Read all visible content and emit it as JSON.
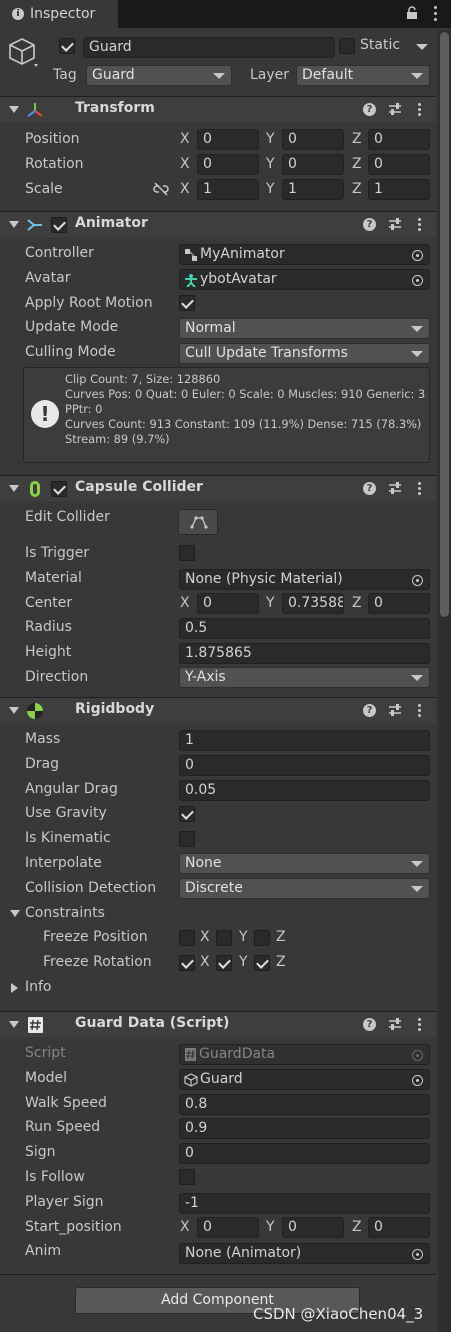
{
  "tab": {
    "title": "Inspector"
  },
  "object": {
    "name": "Guard",
    "static_label": "Static",
    "tag_label": "Tag",
    "tag_value": "Guard",
    "layer_label": "Layer",
    "layer_value": "Default"
  },
  "transform": {
    "title": "Transform",
    "position_label": "Position",
    "rotation_label": "Rotation",
    "scale_label": "Scale",
    "axes": {
      "x": "X",
      "y": "Y",
      "z": "Z"
    },
    "position": {
      "x": "0",
      "y": "0",
      "z": "0"
    },
    "rotation": {
      "x": "0",
      "y": "0",
      "z": "0"
    },
    "scale": {
      "x": "1",
      "y": "1",
      "z": "1"
    }
  },
  "animator": {
    "title": "Animator",
    "controller_label": "Controller",
    "controller_value": "MyAnimator",
    "avatar_label": "Avatar",
    "avatar_value": "ybotAvatar",
    "root_motion_label": "Apply Root Motion",
    "root_motion": true,
    "update_mode_label": "Update Mode",
    "update_mode_value": "Normal",
    "culling_mode_label": "Culling Mode",
    "culling_mode_value": "Cull Update Transforms",
    "info_text": "Clip Count: 7, Size: 128860\nCurves Pos: 0 Quat: 0 Euler: 0 Scale: 0 Muscles: 910 Generic: 3 PPtr: 0\nCurves Count: 913 Constant: 109 (11.9%) Dense: 715 (78.3%) Stream: 89 (9.7%)"
  },
  "capsule": {
    "title": "Capsule Collider",
    "edit_label": "Edit Collider",
    "trigger_label": "Is Trigger",
    "material_label": "Material",
    "material_value": "None (Physic Material)",
    "center_label": "Center",
    "center": {
      "x": "0",
      "y": "0.73588",
      "z": "0"
    },
    "radius_label": "Radius",
    "radius_value": "0.5",
    "height_label": "Height",
    "height_value": "1.875865",
    "direction_label": "Direction",
    "direction_value": "Y-Axis"
  },
  "rigidbody": {
    "title": "Rigidbody",
    "mass_label": "Mass",
    "mass_value": "1",
    "drag_label": "Drag",
    "drag_value": "0",
    "angular_label": "Angular Drag",
    "angular_value": "0.05",
    "gravity_label": "Use Gravity",
    "kinematic_label": "Is Kinematic",
    "interpolate_label": "Interpolate",
    "interpolate_value": "None",
    "collision_label": "Collision Detection",
    "collision_value": "Discrete",
    "constraints_label": "Constraints",
    "freeze_pos_label": "Freeze Position",
    "freeze_rot_label": "Freeze Rotation",
    "info_label": "Info"
  },
  "guard_data": {
    "title": "Guard Data (Script)",
    "script_label": "Script",
    "script_value": "GuardData",
    "model_label": "Model",
    "model_value": "Guard",
    "walk_label": "Walk Speed",
    "walk_value": "0.8",
    "run_label": "Run Speed",
    "run_value": "0.9",
    "sign_label": "Sign",
    "sign_value": "0",
    "follow_label": "Is Follow",
    "player_sign_label": "Player Sign",
    "player_sign_value": "-1",
    "start_label": "Start_position",
    "start": {
      "x": "0",
      "y": "0",
      "z": "0"
    },
    "anim_label": "Anim",
    "anim_value": "None (Animator)"
  },
  "add_component": "Add Component",
  "watermark": "CSDN @XiaoChen04_3"
}
